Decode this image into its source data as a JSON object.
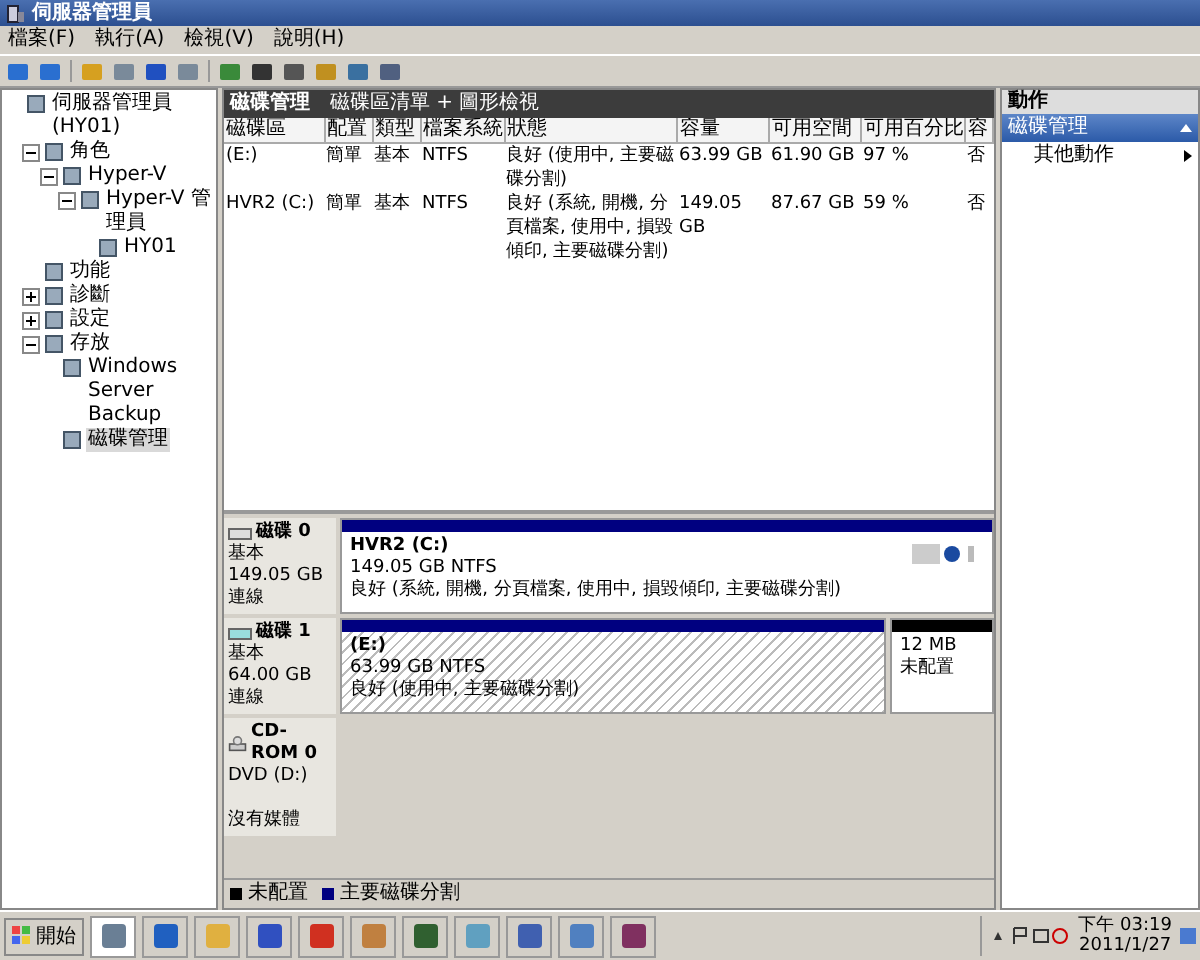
{
  "window": {
    "title": "伺服器管理員"
  },
  "menu": [
    "檔案(F)",
    "執行(A)",
    "檢視(V)",
    "說明(H)"
  ],
  "tree": [
    {
      "label": "伺服器管理員 (HY01)",
      "selected": false,
      "children": [
        {
          "label": "角色",
          "expanded": true,
          "selected": false,
          "children": [
            {
              "label": "Hyper-V",
              "expanded": true,
              "selected": false,
              "children": [
                {
                  "label": "Hyper-V 管理員",
                  "expanded": true,
                  "selected": false,
                  "children": [
                    {
                      "label": "HY01",
                      "selected": false
                    }
                  ]
                }
              ]
            }
          ]
        },
        {
          "label": "功能",
          "selected": false
        },
        {
          "label": "診斷",
          "expanded": false,
          "selected": false
        },
        {
          "label": "設定",
          "expanded": false,
          "selected": false
        },
        {
          "label": "存放",
          "expanded": true,
          "selected": false,
          "children": [
            {
              "label": "Windows Server Backup",
              "selected": false
            },
            {
              "label": "磁碟管理",
              "selected": true
            }
          ]
        }
      ]
    }
  ],
  "center": {
    "title": "磁碟管理",
    "subtitle": "磁碟區清單 + 圖形檢視"
  },
  "table": {
    "columns": [
      "磁碟區",
      "配置",
      "類型",
      "檔案系統",
      "狀態",
      "容量",
      "可用空間",
      "可用百分比",
      "容"
    ],
    "rows": [
      [
        "(E:)",
        "簡單",
        "基本",
        "NTFS",
        "良好 (使用中, 主要磁碟分割)",
        "63.99 GB",
        "61.90 GB",
        "97 %",
        "否"
      ],
      [
        "HVR2 (C:)",
        "簡單",
        "基本",
        "NTFS",
        "良好 (系統, 開機, 分頁檔案, 使用中, 損毀傾印, 主要磁碟分割)",
        "149.05 GB",
        "87.67 GB",
        "59 %",
        "否"
      ]
    ]
  },
  "disks": [
    {
      "kind": "disk",
      "name": "磁碟 0",
      "lines": [
        "基本",
        "149.05 GB",
        "連線"
      ],
      "partitions": [
        {
          "kind": "primary",
          "selected": false,
          "title": "HVR2  (C:)",
          "size": "149.05 GB NTFS",
          "status": "良好 (系統, 開機, 分頁檔案, 使用中, 損毀傾印, 主要磁碟分割)"
        }
      ]
    },
    {
      "kind": "disk",
      "name": "磁碟 1",
      "lines": [
        "基本",
        "64.00 GB",
        "連線"
      ],
      "partitions": [
        {
          "kind": "primary",
          "selected": true,
          "title": "(E:)",
          "size": "63.99 GB NTFS",
          "status": "良好 (使用中, 主要磁碟分割)"
        },
        {
          "kind": "unallocated",
          "selected": false,
          "size": "12 MB",
          "status": "未配置"
        }
      ]
    },
    {
      "kind": "cdrom",
      "name": "CD-ROM 0",
      "lines": [
        "DVD (D:)",
        "沒有媒體"
      ]
    }
  ],
  "legend": [
    {
      "label": "未配置",
      "color": "#000000"
    },
    {
      "label": "主要磁碟分割",
      "color": "#000080"
    }
  ],
  "actions": {
    "title": "動作",
    "section": "磁碟管理",
    "items": [
      "其他動作"
    ]
  },
  "taskbar": {
    "start": "開始",
    "time": "下午 03:19",
    "date": "2011/1/27"
  }
}
